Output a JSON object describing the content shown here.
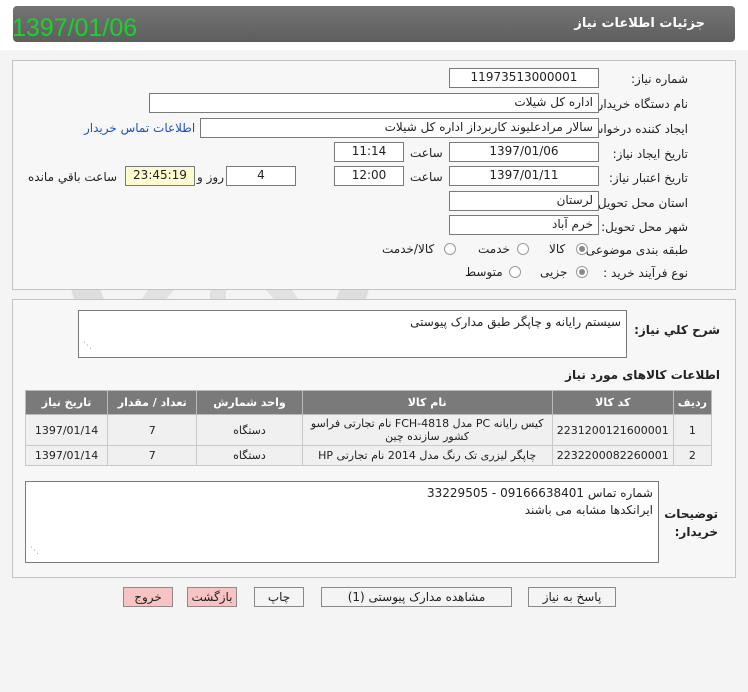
{
  "header": {
    "title": "جزئیات اطلاعات نیاز",
    "date": "1397/01/06"
  },
  "info": {
    "need_number_label": "شماره نیاز:",
    "need_number": "11973513000001",
    "buyer_org_label": "نام دستگاه خریدار:",
    "buyer_org": "اداره کل شیلات",
    "requester_label": "ایجاد کننده درخواست:",
    "requester": "سالار مرادعلیوند کاربرداز اداره کل شیلات",
    "contact_link": "اطلاعات تماس خریدار",
    "created_label": "تاریخ ایجاد نیاز:",
    "created_date": "1397/01/06",
    "time_label": "ساعت",
    "created_time": "11:14",
    "valid_label": "تاریخ اعتبار نیاز:",
    "valid_date": "1397/01/11",
    "valid_time": "12:00",
    "days": "4",
    "days_label": "روز و",
    "countdown": "23:45:19",
    "remaining_label": "ساعت باقي مانده",
    "province_label": "استان محل تحویل:",
    "province": "لرستان",
    "city_label": "شهر محل تحویل:",
    "city": "خرم آباد",
    "category_label": "طبقه بندی موضوعی:",
    "category_options": [
      "کالا",
      "خدمت",
      "کالا/خدمت"
    ],
    "process_label": "نوع فرآیند خرید :",
    "process_options": [
      "جزیی",
      "متوسط"
    ]
  },
  "description": {
    "label": "شرح کلي نياز:",
    "text": "سیستم رایانه و چاپگر طبق مدارک پیوستی"
  },
  "items_section": {
    "title": "اطلاعات کالاهای مورد نیاز",
    "columns": [
      "ردیف",
      "کد کالا",
      "نام کالا",
      "واحد شمارش",
      "تعداد / مقدار",
      "تاریخ نیاز"
    ],
    "rows": [
      {
        "idx": "1",
        "code": "2231200121600001",
        "name": "کیس رایانه PC مدل FCH-4818 نام تجارتی فراسو کشور سازنده چین",
        "unit": "دستگاه",
        "qty": "7",
        "date": "1397/01/14"
      },
      {
        "idx": "2",
        "code": "2232200082260001",
        "name": "چاپگر لیزری تک رنگ مدل 2014 نام تجارتی HP",
        "unit": "دستگاه",
        "qty": "7",
        "date": "1397/01/14"
      }
    ]
  },
  "buyer_notes": {
    "label_line1": "توضیحات",
    "label_line2": "خریدار:",
    "line1": "شماره تماس 09166638401 - 33229505",
    "line2": "ایرانکدها مشابه می باشند"
  },
  "buttons": {
    "reply": "پاسخ به نیاز",
    "attachments": "مشاهده مدارک پیوستی (1)",
    "print": "چاپ",
    "back": "بازگشت",
    "exit": "خروج"
  }
}
